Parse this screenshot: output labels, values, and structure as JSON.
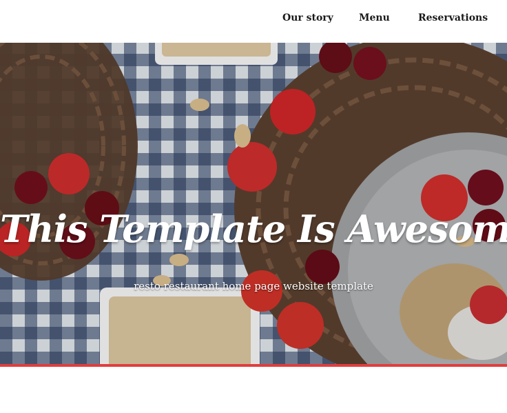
{
  "nav": {
    "items": [
      {
        "label": "Our story"
      },
      {
        "label": "Menu"
      },
      {
        "label": "Reservations"
      }
    ]
  },
  "hero": {
    "title": "This Template Is Awesome",
    "subtitle": "resto restaurant home page website template"
  },
  "colors": {
    "accent": "#e03e3e",
    "nav_text": "#1a1a1a",
    "hero_text": "#ffffff"
  }
}
